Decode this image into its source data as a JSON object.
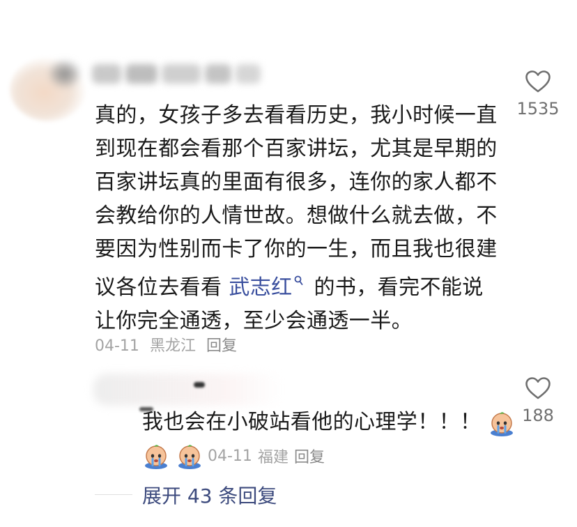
{
  "comment": {
    "text_part1": "真的，女孩子多去看看历史，我小时候一直到现在都会看那个百家讲坛，尤其是早期的百家讲坛真的里面有很多，连你的家人都不会教给你的人情世故。想做什么就去做，不要因为性别而卡了你的一生，而且我也很建议各位去看看 ",
    "keyword": "武志红",
    "text_part2": " 的书，看完不能说让你完全通透，至少会通透一半。",
    "date": "04-11",
    "location": "黑龙江",
    "reply_label": "回复",
    "likes": "1535"
  },
  "reply": {
    "text": "我也会在小破站看他的心理学！！！",
    "date": "04-11",
    "location": "福建",
    "reply_label": "回复",
    "likes": "188"
  },
  "expand": {
    "label": "展开 43 条回复"
  },
  "icons": {
    "like": "heart-outline-icon",
    "emoji": "crying-face-emoji",
    "search": "search-icon"
  },
  "colors": {
    "text": "#1a1a1a",
    "meta": "#a3a3a3",
    "link": "#3a4f9e",
    "expand": "#3c4a7d"
  }
}
